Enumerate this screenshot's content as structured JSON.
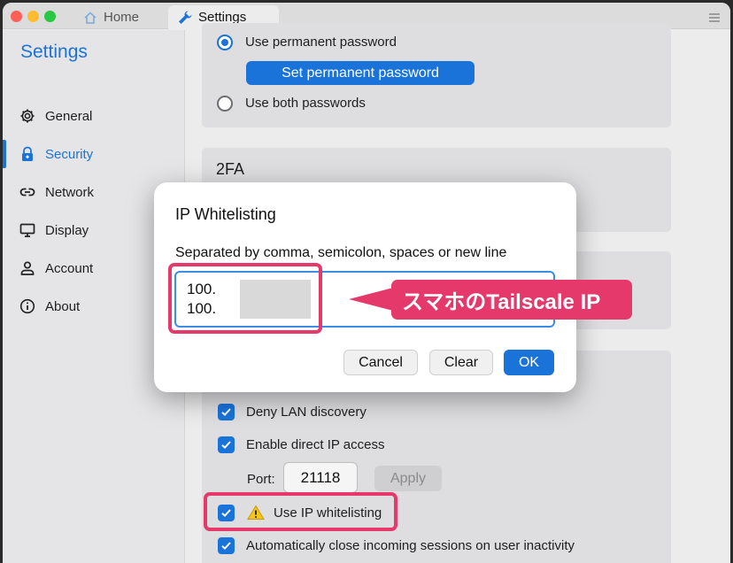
{
  "window": {
    "tabs": [
      {
        "label": "Home",
        "icon": "home-icon"
      },
      {
        "label": "Settings",
        "icon": "wrench-icon"
      }
    ]
  },
  "sidebar": {
    "title": "Settings",
    "items": [
      {
        "label": "General",
        "icon": "gear-icon"
      },
      {
        "label": "Security",
        "icon": "lock-icon",
        "active": true
      },
      {
        "label": "Network",
        "icon": "link-icon"
      },
      {
        "label": "Display",
        "icon": "monitor-icon"
      },
      {
        "label": "Account",
        "icon": "person-icon"
      },
      {
        "label": "About",
        "icon": "info-icon"
      }
    ]
  },
  "main": {
    "password": {
      "use_permanent": "Use permanent password",
      "set_permanent_button": "Set permanent password",
      "use_both": "Use both passwords"
    },
    "twofa_title": "2FA",
    "deny_lan": "Deny LAN discovery",
    "enable_direct_ip": "Enable direct IP access",
    "port_label": "Port:",
    "port_value": "21118",
    "apply_button": "Apply",
    "use_ip_whitelisting": "Use IP whitelisting",
    "auto_close": "Automatically close incoming sessions on user inactivity"
  },
  "dialog": {
    "title": "IP Whitelisting",
    "description": "Separated by comma, semicolon, spaces or new line",
    "ip_lines": [
      "100.",
      "100."
    ],
    "cancel": "Cancel",
    "clear": "Clear",
    "ok": "OK"
  },
  "annotation": {
    "callout": "スマホのTailscale IP"
  },
  "colors": {
    "accent": "#1a73d9",
    "highlight": "#e5396c"
  }
}
